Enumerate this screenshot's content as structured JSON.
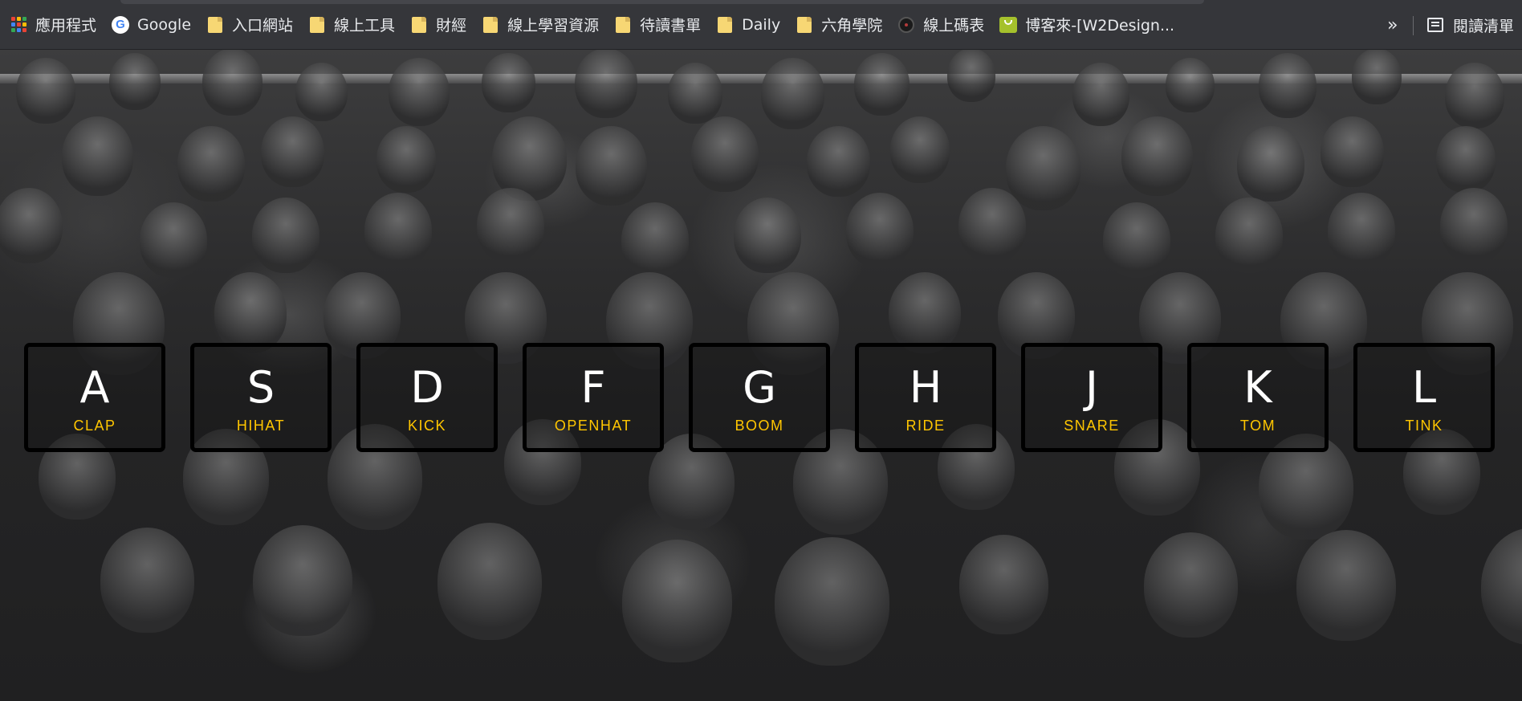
{
  "browser": {
    "bookmarks": [
      {
        "label": "應用程式",
        "icon": "apps-grid-icon"
      },
      {
        "label": "Google",
        "icon": "google-icon"
      },
      {
        "label": "入口網站",
        "icon": "folder-icon"
      },
      {
        "label": "線上工具",
        "icon": "folder-icon"
      },
      {
        "label": "財經",
        "icon": "folder-icon"
      },
      {
        "label": "線上學習資源",
        "icon": "folder-icon"
      },
      {
        "label": "待讀書單",
        "icon": "folder-icon"
      },
      {
        "label": "Daily",
        "icon": "folder-icon"
      },
      {
        "label": "六角學院",
        "icon": "folder-icon"
      },
      {
        "label": "線上碼表",
        "icon": "stopwatch-icon"
      },
      {
        "label": "博客來-[W2Design...",
        "icon": "shopping-bag-icon"
      }
    ],
    "overflow_label": "»",
    "reading_list_label": "閱讀清單"
  },
  "drumkit": {
    "keys": [
      {
        "letter": "A",
        "sound": "CLAP"
      },
      {
        "letter": "S",
        "sound": "HIHAT"
      },
      {
        "letter": "D",
        "sound": "KICK"
      },
      {
        "letter": "F",
        "sound": "OPENHAT"
      },
      {
        "letter": "G",
        "sound": "BOOM"
      },
      {
        "letter": "H",
        "sound": "RIDE"
      },
      {
        "letter": "J",
        "sound": "SNARE"
      },
      {
        "letter": "K",
        "sound": "TOM"
      },
      {
        "letter": "L",
        "sound": "TINK"
      }
    ]
  },
  "colors": {
    "bookmark_bar": "#35363a",
    "key_border": "#000000",
    "key_letter": "#ffffff",
    "key_sound": "#ffc600",
    "folder": "#f7d774"
  },
  "background": {
    "icon": "crowd-photo-icon"
  }
}
